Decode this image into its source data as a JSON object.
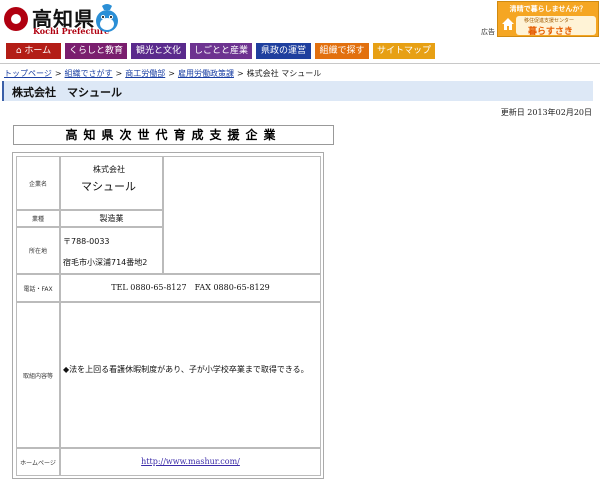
{
  "header": {
    "logo_jp": "高知県",
    "logo_en": "Kochi Prefecture",
    "ad_label": "広告",
    "banner_line1": "清晴で暮らしませんか？",
    "banner_line2a": "移住促進支援センター",
    "banner_line2b": "暮らすさき"
  },
  "nav": [
    {
      "label": "ホーム",
      "color": "#b31d16"
    },
    {
      "label": "くらしと教育",
      "color": "#7a1e6e"
    },
    {
      "label": "観光と文化",
      "color": "#5a2a8c"
    },
    {
      "label": "しごとと産業",
      "color": "#6d3390"
    },
    {
      "label": "県政の運営",
      "color": "#1f3f9e"
    },
    {
      "label": "組織で探す",
      "color": "#e2700e"
    },
    {
      "label": "サイトマップ",
      "color": "#e7a014"
    }
  ],
  "breadcrumb": {
    "items": [
      "トップページ",
      "組織でさがす",
      "商工労働部",
      "雇用労働政策課"
    ],
    "current": "株式会社 マシュール"
  },
  "page": {
    "title": "株式会社　マシュール",
    "updated": "更新日 2013年02月20日"
  },
  "card": {
    "title": "高知県次世代育成支援企業",
    "rows": {
      "name_label": "企業名",
      "name_small": "株式会社",
      "name_big": "マシュール",
      "industry_label": "業種",
      "industry": "製造業",
      "address_label": "所在地",
      "zip": "〒788-0033",
      "address": "宿毛市小深浦714番地2",
      "phone_label": "電話・FAX",
      "phone": "TEL 0880-65-8127　FAX 0880-65-8129",
      "content_label": "取組内容等",
      "content": "◆法を上回る看護休暇制度があり、子が小学校卒業まで取得できる。",
      "hp_label": "ホームページ",
      "hp": "http://www.mashur.com/"
    }
  }
}
